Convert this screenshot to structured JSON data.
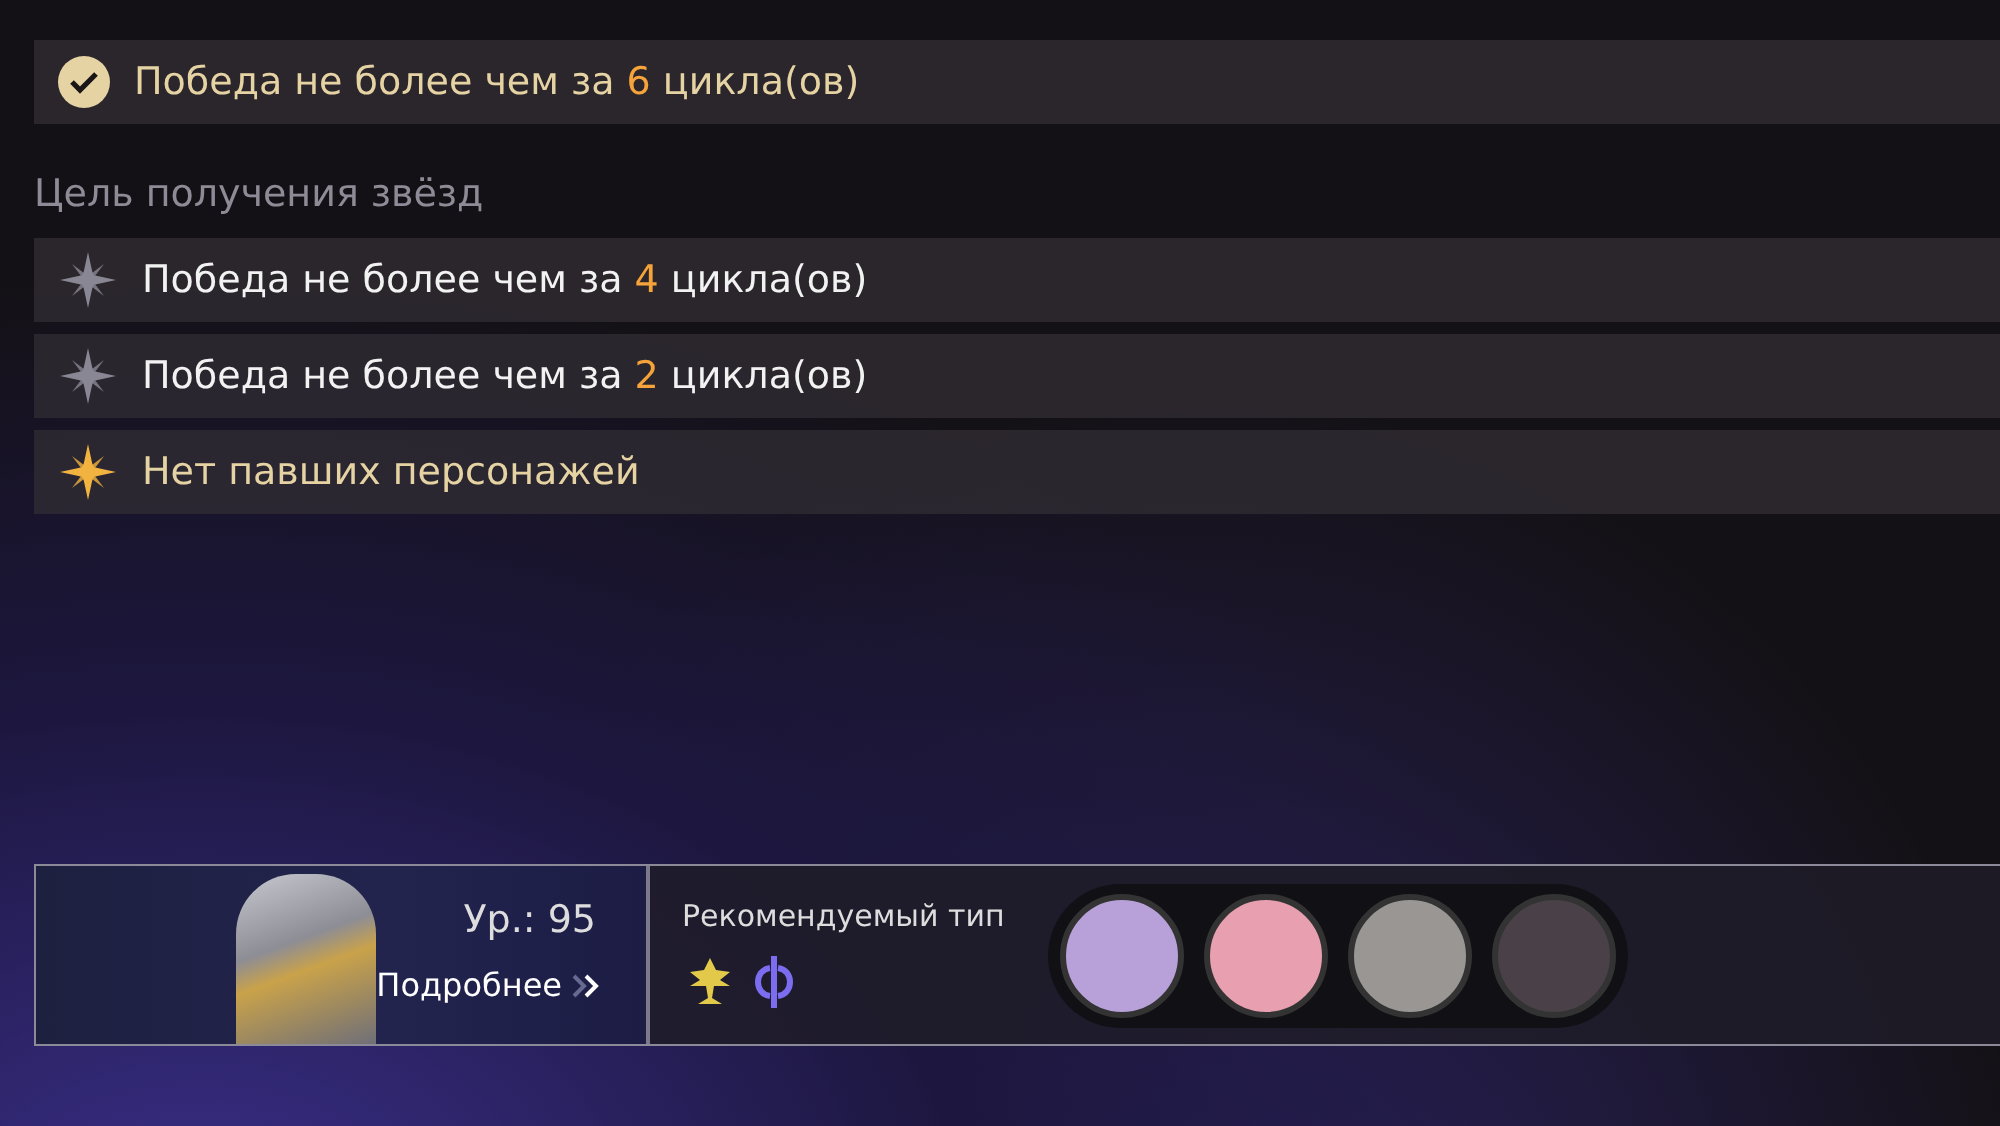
{
  "main_goal": {
    "completed": true,
    "prefix": "Победа не более чем за",
    "count": "6",
    "suffix": "цикла(ов)"
  },
  "star_goals_heading": "Цель получения звёзд",
  "star_goals": [
    {
      "achieved": false,
      "prefix": "Победа не более чем за",
      "count": "4",
      "suffix": "цикла(ов)"
    },
    {
      "achieved": false,
      "prefix": "Победа не более чем за",
      "count": "2",
      "suffix": "цикла(ов)"
    },
    {
      "achieved": true,
      "prefix": "Нет павших персонажей"
    }
  ],
  "enemy": {
    "level": "Ур.: 95",
    "details_link": "Подробнее"
  },
  "recommended": {
    "label": "Рекомендуемый тип",
    "types": [
      {
        "kind": "path"
      },
      {
        "kind": "element"
      }
    ],
    "characters": [
      {
        "kind": "portrait"
      },
      {
        "kind": "portrait"
      },
      {
        "kind": "portrait"
      },
      {
        "kind": "portrait"
      }
    ]
  }
}
